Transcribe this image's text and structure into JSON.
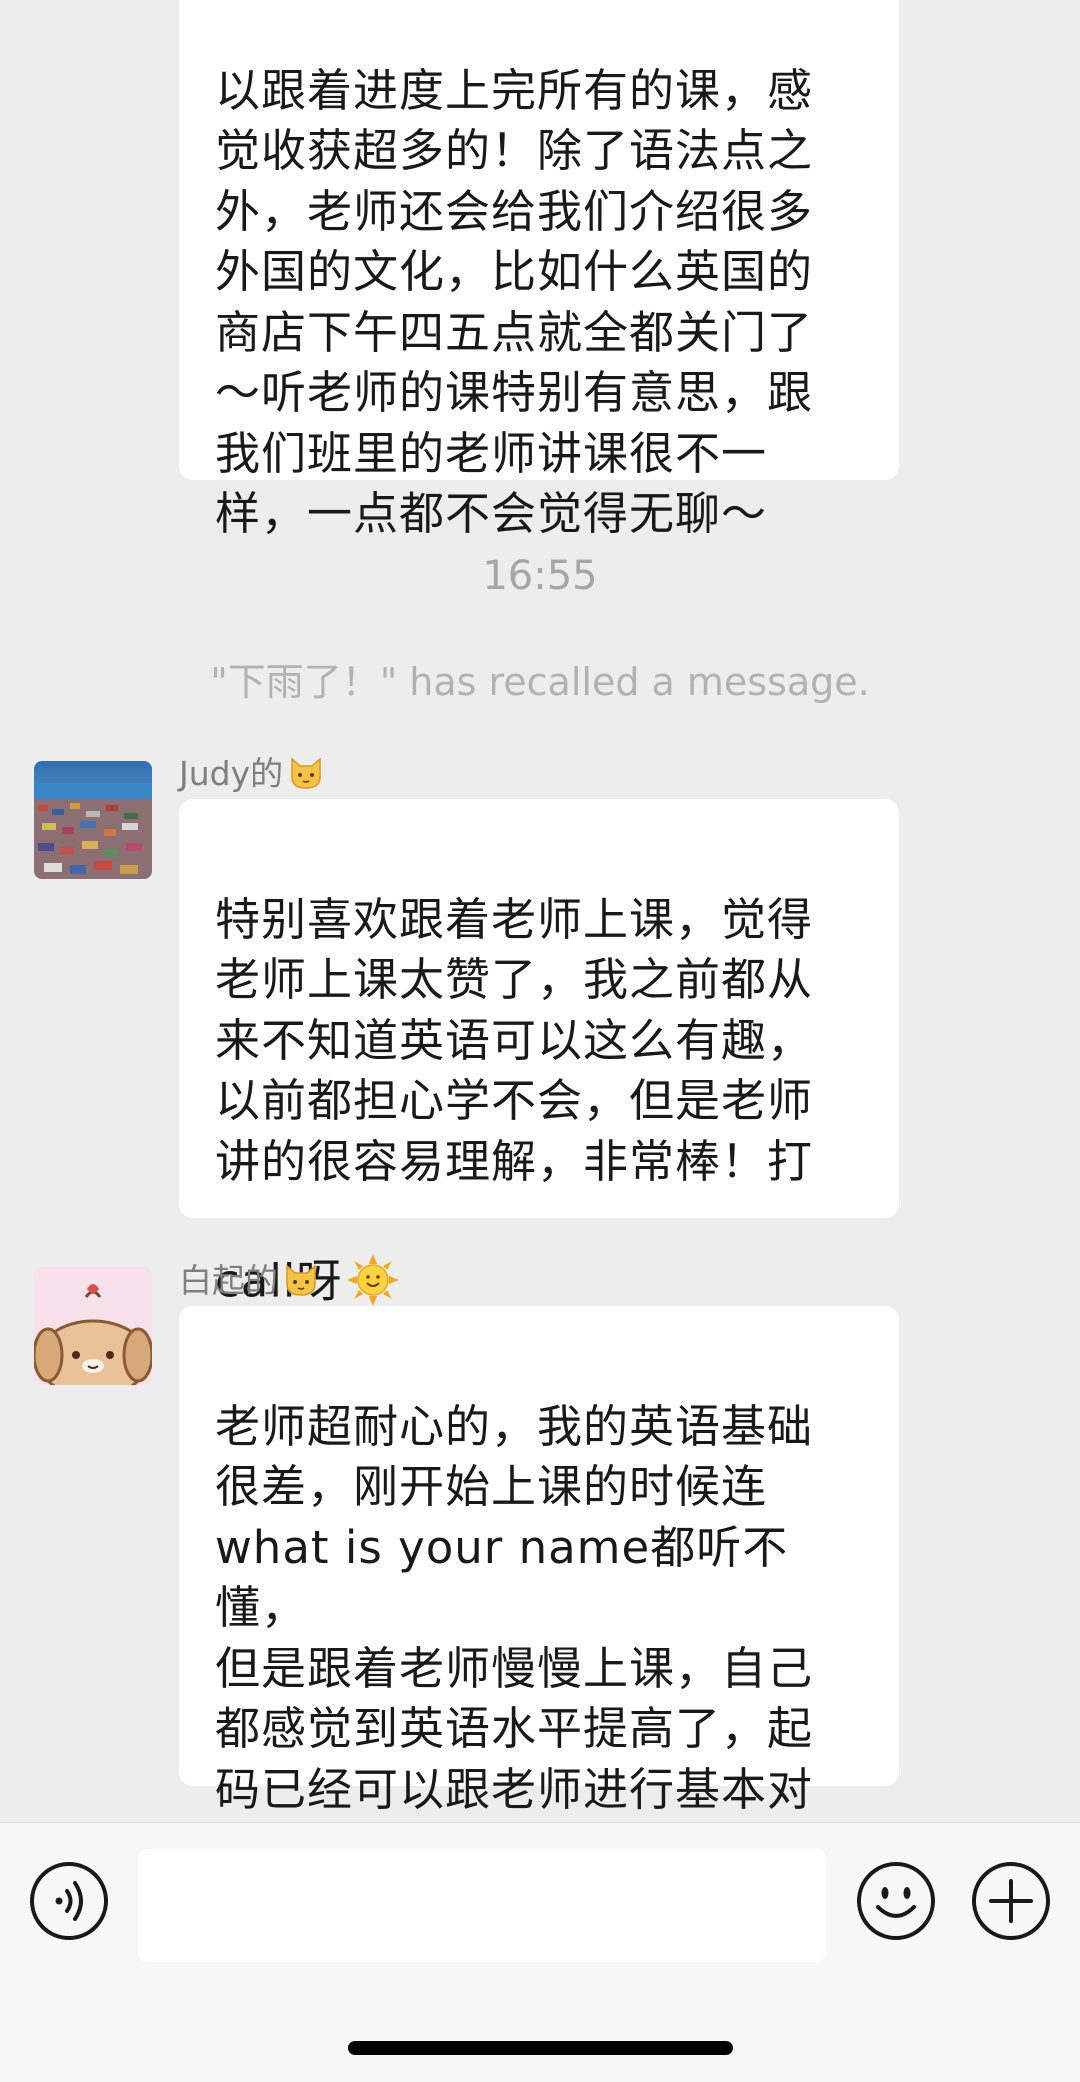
{
  "messages": [
    {
      "text": "以跟着进度上完所有的课，感\n觉收获超多的！除了语法点之\n外，老师还会给我们介绍很多\n外国的文化，比如什么英国的\n商店下午四五点就全都关门了\n～听老师的课特别有意思，跟\n我们班里的老师讲课很不一\n样，一点都不会觉得无聊～"
    },
    {
      "sender": "Judy的",
      "text": "特别喜欢跟着老师上课，觉得\n老师上课太赞了，我之前都从\n来不知道英语可以这么有趣，\n以前都担心学不会，但是老师\n讲的很容易理解，非常棒！打\ncall呀",
      "emoji": "sun-smile-icon"
    },
    {
      "sender": "白起的",
      "text": "老师超耐心的，我的英语基础\n很差，刚开始上课的时候连\nwhat is your name都听不懂，\n但是跟着老师慢慢上课，自己\n都感觉到英语水平提高了，起\n码已经可以跟老师进行基本对\n话了。我要继续好好学习！"
    }
  ],
  "timestamp": "16:55",
  "recall_notice": "\"下雨了！\" has recalled a message.",
  "input": {
    "value": "",
    "placeholder": ""
  },
  "icons": {
    "voice": "voice-icon",
    "emoji": "emoji-icon",
    "plus": "plus-icon",
    "sender_badge": "cat-face-icon"
  },
  "colors": {
    "background": "#ededed",
    "bubble": "#ffffff",
    "text": "#191919",
    "meta_text": "#a6a6a6",
    "sender_text": "#7f7f7f",
    "input_bar": "#f7f7f7"
  }
}
